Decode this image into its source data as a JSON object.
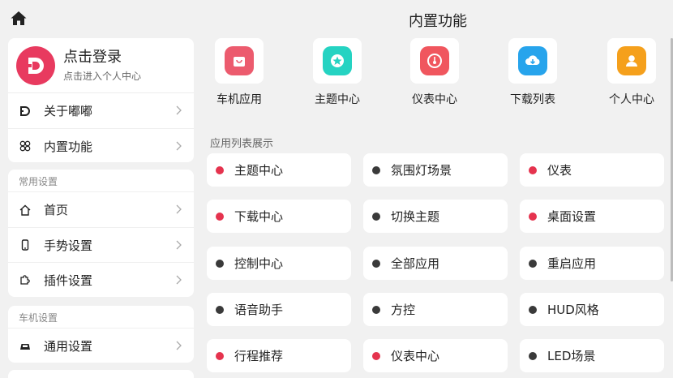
{
  "header": {
    "title": "内置功能",
    "home_icon": "home-icon"
  },
  "profile": {
    "name": "点击登录",
    "subtitle": "点击进入个人中心",
    "avatar_color": "#e83a5f"
  },
  "menu_top": [
    {
      "label": "关于嘟嘟",
      "icon": "dudu-logo-icon"
    },
    {
      "label": "内置功能",
      "icon": "clover-icon"
    }
  ],
  "common_settings": {
    "heading": "常用设置",
    "items": [
      {
        "label": "首页",
        "icon": "home-outline-icon"
      },
      {
        "label": "手势设置",
        "icon": "phone-icon"
      },
      {
        "label": "插件设置",
        "icon": "puzzle-icon"
      }
    ]
  },
  "car_settings": {
    "heading": "车机设置",
    "items": [
      {
        "label": "通用设置",
        "icon": "car-icon"
      }
    ]
  },
  "apps": [
    {
      "label": "车机应用",
      "icon": "bag-icon",
      "color": "#ec5b6e"
    },
    {
      "label": "主题中心",
      "icon": "star-icon",
      "color": "#25d3c2"
    },
    {
      "label": "仪表中心",
      "icon": "gauge-icon",
      "color": "#f0565e"
    },
    {
      "label": "下载列表",
      "icon": "cloud-download-icon",
      "color": "#27a4ec"
    },
    {
      "label": "个人中心",
      "icon": "person-icon",
      "color": "#f5a01c"
    }
  ],
  "list_heading": "应用列表展示",
  "colors": {
    "red_dot": "#e5334e",
    "dark_dot": "#3a3a3a"
  },
  "list_items": [
    {
      "label": "主题中心",
      "dot": "red"
    },
    {
      "label": "氛围灯场景",
      "dot": "dark"
    },
    {
      "label": "仪表",
      "dot": "red"
    },
    {
      "label": "下载中心",
      "dot": "red"
    },
    {
      "label": "切换主题",
      "dot": "dark"
    },
    {
      "label": "桌面设置",
      "dot": "red"
    },
    {
      "label": "控制中心",
      "dot": "dark"
    },
    {
      "label": "全部应用",
      "dot": "dark"
    },
    {
      "label": "重启应用",
      "dot": "dark"
    },
    {
      "label": "语音助手",
      "dot": "dark"
    },
    {
      "label": "方控",
      "dot": "dark"
    },
    {
      "label": "HUD风格",
      "dot": "dark"
    },
    {
      "label": "行程推荐",
      "dot": "red"
    },
    {
      "label": "仪表中心",
      "dot": "red"
    },
    {
      "label": "LED场景",
      "dot": "dark"
    }
  ]
}
